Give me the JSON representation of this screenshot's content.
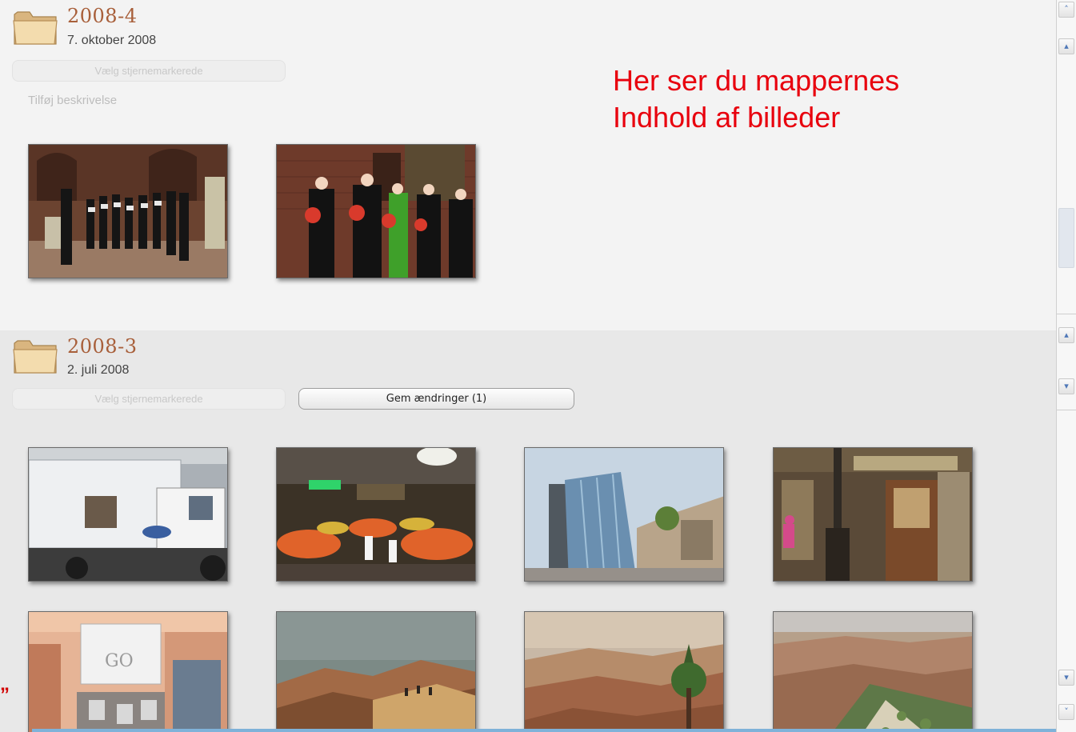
{
  "folders": [
    {
      "title": "2008-4",
      "date": "7. oktober 2008",
      "select_starred_label": "Vælg stjernemarkerede",
      "add_description_label": "Tilføj beskrivelse"
    },
    {
      "title": "2008-3",
      "date": "2. juli 2008",
      "select_starred_label": "Vælg stjernemarkerede",
      "save_changes_label": "Gem ændringer (1)"
    }
  ],
  "note": {
    "line1": "Her ser du mappernes",
    "line2": "Indhold af billeder"
  },
  "edge_mark": "”",
  "colors": {
    "folder_title": "#a85f3a",
    "note_text": "#e8000d",
    "scroll_arrow": "#4f78b8",
    "accent_line": "#7fb2d9"
  },
  "icons": {
    "folder": "folder-icon",
    "scroll_top": "double-chevron-up-icon",
    "scroll_up": "chevron-up-icon",
    "scroll_down": "chevron-down-icon",
    "scroll_bottom": "double-chevron-down-icon"
  }
}
